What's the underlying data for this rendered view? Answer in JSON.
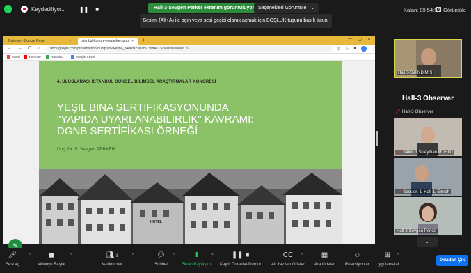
{
  "topbar": {
    "recording_label": "Kaydediliyor...",
    "pause_icon": "pause-icon",
    "stop_icon": "stop-icon",
    "share_banner": "Hall-3-Sevgen Perker ekranını görüntülüyorsunuz",
    "view_options_label": "Seçenekleri Görüntüle",
    "timer_label": "Kalan: 09:54:56",
    "view_right_label": "Görüntüle"
  },
  "tooltip": {
    "text": "Sesimi (Alt+A) ile açın veya sesi geçici olarak açmak için BOŞLUK tuşunu basılı tutun."
  },
  "browser": {
    "tabs": [
      {
        "label": "Drive'ım - Google Drive",
        "close": "×"
      },
      {
        "label": "İstanbul-kongre-sseperke-sunur",
        "close": "×"
      }
    ],
    "new_tab": "+",
    "url": "docs.google.com/presentation/d/1fqsv8vo4cjhk_p4dRfkZNrZhiZ3ubA51Sc/edit#slide=id.p1",
    "bookmarks": [
      {
        "label": "Gmail",
        "color": "#ea4335"
      },
      {
        "label": "YouTube",
        "color": "#ff0000"
      },
      {
        "label": "Haritalar",
        "color": "#34a853"
      },
      {
        "label": "Google Çeviri",
        "color": "#4285f4"
      }
    ],
    "slide": {
      "congress": "4. ULUSLARASI İSTANBUL GÜNCEL BİLİMSEL ARAŞTIRMALAR KONGRESİ",
      "title": "YEŞİL BİNA SERTİFİKASYONUNDA\n\"YAPIDA UYARLANABİLİRLİK\" KAVRAMI:\nDGNB SERTİFİKASI ÖRNEĞİ",
      "author": "Doç. Dr. Z. Sevgen PERKER",
      "photo_sign": "HOTEL",
      "bg_color": "#8cc267"
    }
  },
  "panel": {
    "self_name": "Hall-3-Salih DİMİS",
    "observer_title": "Hall-3 Observer",
    "observer_name": "Hall-3 Observer",
    "participants": [
      {
        "name": "Salon 3,Süleyman MÜFTÜ"
      },
      {
        "name": "Session-1, Hall-1, Emrah"
      },
      {
        "name": "Hall-3-Sevgen Perker"
      }
    ]
  },
  "toolbar": {
    "audio": "Sesi aç",
    "video": "Videoyu Başlat",
    "participants": "Katılımcılar",
    "participants_count": "8",
    "chat": "Sohbet",
    "share": "Ekran Paylaşımı",
    "pause_rec": "Kaydı Duraklat/Durdur",
    "captions": "Alt Yazıları Göster",
    "breakout": "Ara Odalar",
    "reactions": "Reaksiyonlar",
    "apps": "Uygulamalar",
    "leave": "Odadan Çık"
  }
}
